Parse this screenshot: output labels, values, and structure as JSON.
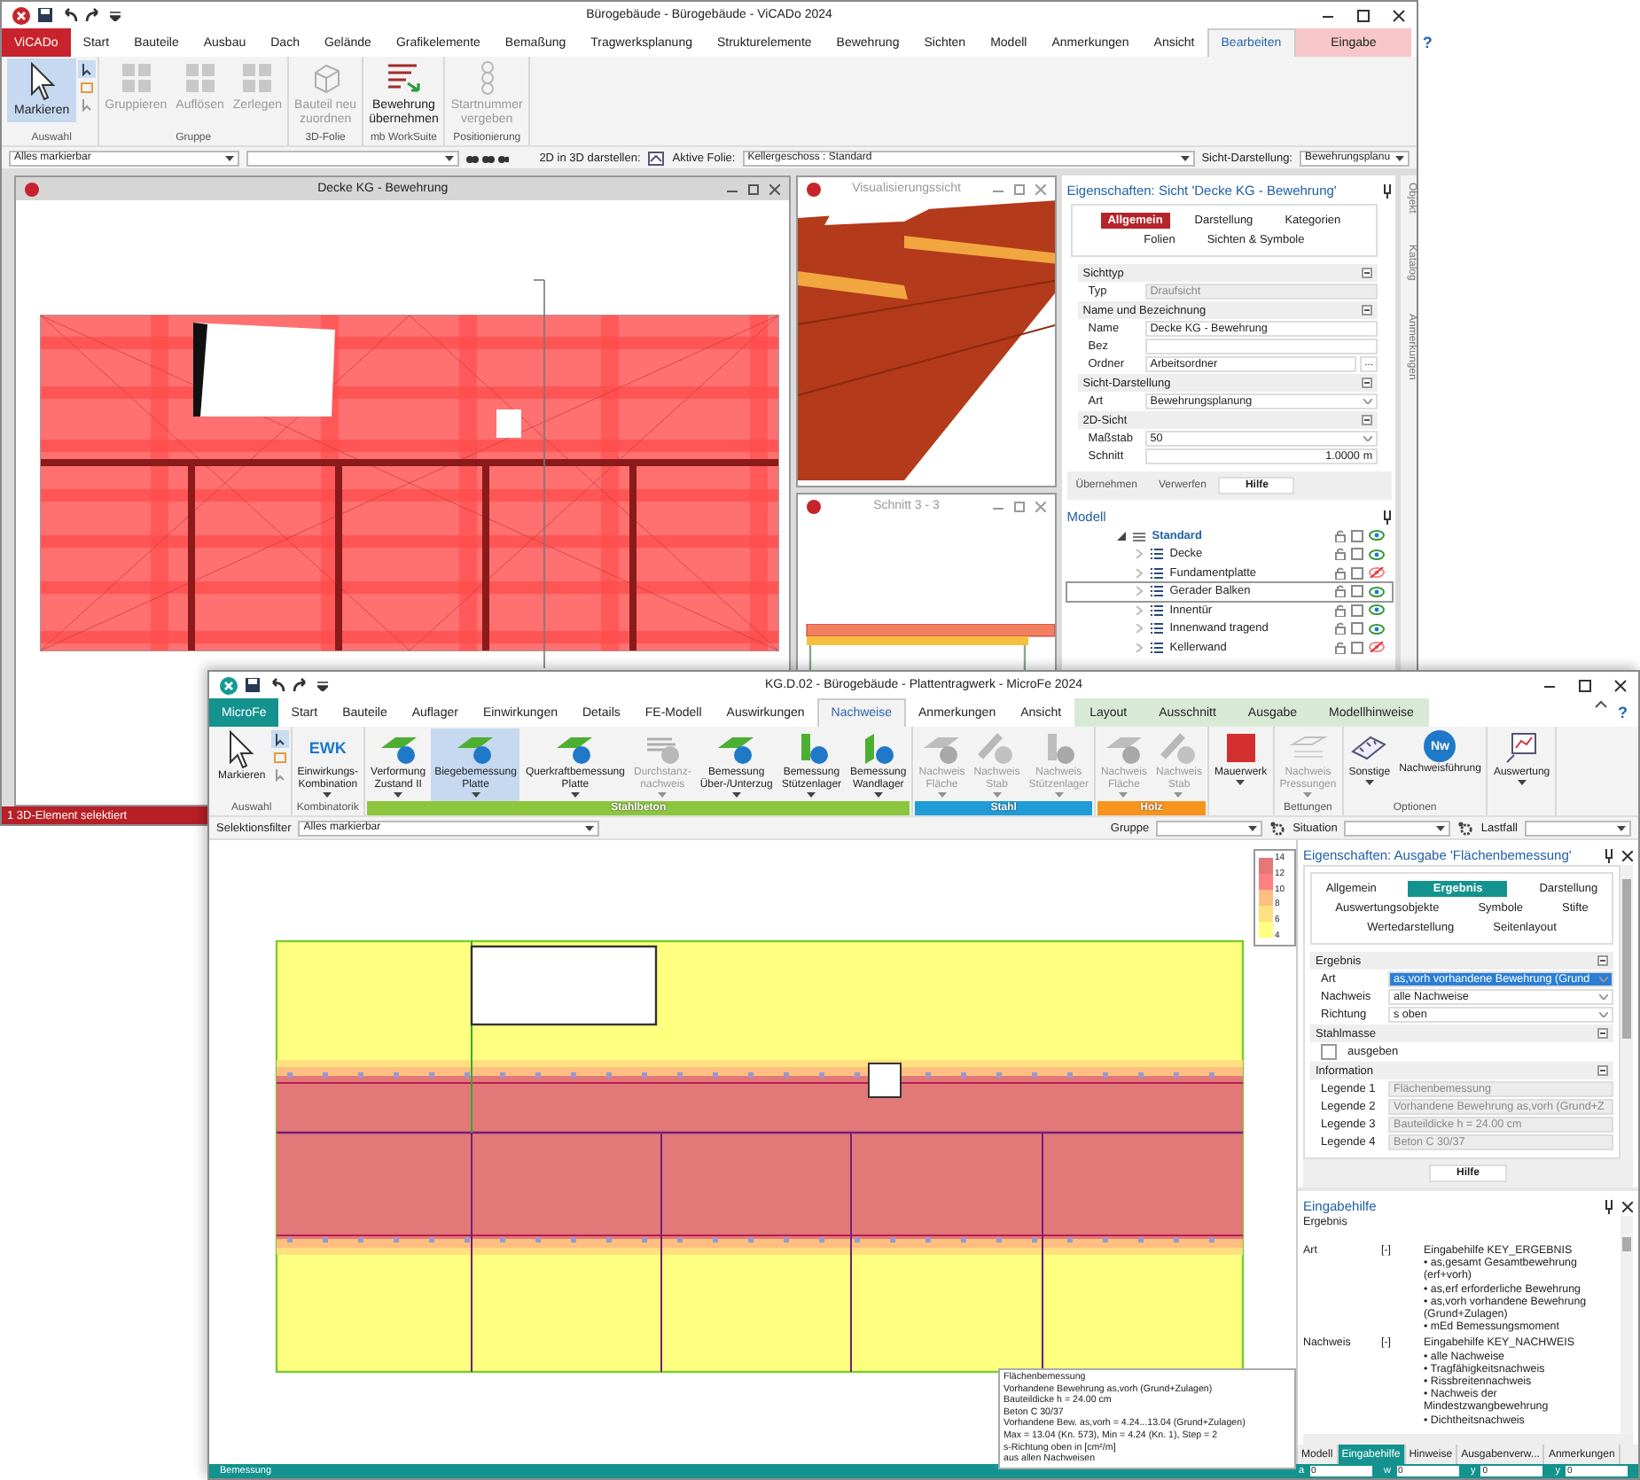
{
  "vicado": {
    "title": "Bürogebäude - Bürogebäude - ViCADo 2024",
    "help": "?",
    "tabs": [
      {
        "label": "ViCADo",
        "kind": "file",
        "selected": false
      },
      {
        "label": "Start",
        "kind": "tab",
        "selected": false
      },
      {
        "label": "Bauteile",
        "kind": "tab",
        "selected": false
      },
      {
        "label": "Ausbau",
        "kind": "tab",
        "selected": false
      },
      {
        "label": "Dach",
        "kind": "tab",
        "selected": false
      },
      {
        "label": "Gelände",
        "kind": "tab",
        "selected": false
      },
      {
        "label": "Grafikelemente",
        "kind": "tab",
        "selected": false
      },
      {
        "label": "Bemaßung",
        "kind": "tab",
        "selected": false
      },
      {
        "label": "Tragwerksplanung",
        "kind": "tab",
        "selected": false
      },
      {
        "label": "Strukturelemente",
        "kind": "tab",
        "selected": false
      },
      {
        "label": "Bewehrung",
        "kind": "tab",
        "selected": false
      },
      {
        "label": "Sichten",
        "kind": "tab",
        "selected": false
      },
      {
        "label": "Modell",
        "kind": "tab",
        "selected": false
      },
      {
        "label": "Anmerkungen",
        "kind": "tab",
        "selected": false
      },
      {
        "label": "Ansicht",
        "kind": "tab",
        "selected": false
      },
      {
        "label": "Bearbeiten",
        "kind": "tab",
        "selected": true
      },
      {
        "label": "Eingabe",
        "kind": "context",
        "selected": false
      }
    ],
    "ribbon": [
      {
        "label": "Auswahl",
        "buttons": [
          {
            "lines": [
              "Markieren"
            ],
            "kind": "cursor",
            "selected": true,
            "disabled": false
          }
        ]
      },
      {
        "label": "Gruppe",
        "buttons": [
          {
            "lines": [
              "Gruppieren"
            ],
            "kind": "group",
            "selected": false,
            "disabled": true
          },
          {
            "lines": [
              "Auflösen"
            ],
            "kind": "group",
            "selected": false,
            "disabled": true
          },
          {
            "lines": [
              "Zerlegen"
            ],
            "kind": "group",
            "selected": false,
            "disabled": true
          }
        ]
      },
      {
        "label": "3D-Folie",
        "buttons": [
          {
            "lines": [
              "Bauteil neu",
              "zuordnen"
            ],
            "kind": "cube",
            "selected": false,
            "disabled": true
          }
        ]
      },
      {
        "label": "mb WorkSuite",
        "buttons": [
          {
            "lines": [
              "Bewehrung",
              "übernehmen"
            ],
            "kind": "rebar",
            "selected": false,
            "disabled": false
          }
        ]
      },
      {
        "label": "Positionierung",
        "buttons": [
          {
            "lines": [
              "Startnummer",
              "vergeben"
            ],
            "kind": "number",
            "selected": false,
            "disabled": true
          }
        ]
      }
    ],
    "toolbar": {
      "selection": "Alles markierbar",
      "show_3d_label": "2D in 3D darstellen:",
      "layer_label": "Aktive Folie:",
      "layer": "Kellergeschoss : Standard",
      "style_label": "Sicht-Darstellung:",
      "style": "Bewehrungsplanu"
    },
    "views": [
      {
        "title": "Decke KG - Bewehrung",
        "kind": "plan"
      },
      {
        "title": "Visualisierungssicht",
        "kind": "render"
      },
      {
        "title": "Schnitt 3 - 3",
        "kind": "section"
      }
    ],
    "properties": {
      "title": "Eigenschaften: Sicht 'Decke KG - Bewehrung'",
      "tabs": [
        {
          "label": "Allgemein",
          "selected": true
        },
        {
          "label": "Darstellung",
          "selected": false
        },
        {
          "label": "Kategorien",
          "selected": false
        },
        {
          "label": "Folien",
          "selected": false
        },
        {
          "label": "Sichten & Symbole",
          "selected": false
        }
      ],
      "sections": [
        {
          "label": "Sichttyp",
          "rows": [
            {
              "label": "Typ",
              "value": "Draufsicht",
              "kind": "readonly"
            }
          ]
        },
        {
          "label": "Name und Bezeichnung",
          "rows": [
            {
              "label": "Name",
              "value": "Decke KG - Bewehrung",
              "kind": "text"
            },
            {
              "label": "Bez",
              "kind": "text"
            },
            {
              "label": "Ordner",
              "value": "Arbeitsordner",
              "kind": "browse",
              "button": "..."
            }
          ]
        },
        {
          "label": "Sicht-Darstellung",
          "rows": [
            {
              "label": "Art",
              "value": "Bewehrungsplanung",
              "kind": "dropdown"
            }
          ]
        },
        {
          "label": "2D-Sicht",
          "rows": [
            {
              "label": "Maßstab",
              "value": "50",
              "kind": "dropdown"
            },
            {
              "label": "Schnitt",
              "value": "1.0000",
              "unit": "m",
              "kind": "unit"
            }
          ]
        }
      ],
      "buttons": [
        {
          "label": "Übernehmen",
          "kind": "plain"
        },
        {
          "label": "Verwerfen",
          "kind": "plain"
        },
        {
          "label": "Hilfe",
          "kind": "bold"
        }
      ]
    },
    "model": {
      "title": "Modell",
      "tree": [
        {
          "label": "Standard",
          "expanded": true,
          "visible": true,
          "selected": false,
          "children": [
            {
              "label": "Decke",
              "expanded": false,
              "visible": true,
              "selected": false
            },
            {
              "label": "Fundamentplatte",
              "expanded": false,
              "visible": false,
              "selected": false
            },
            {
              "label": "Gerader Balken",
              "expanded": false,
              "visible": true,
              "selected": true
            },
            {
              "label": "Innentür",
              "expanded": false,
              "visible": true,
              "selected": false
            },
            {
              "label": "Innenwand tragend",
              "expanded": false,
              "visible": true,
              "selected": false
            },
            {
              "label": "Kellerwand",
              "expanded": false,
              "visible": false,
              "selected": false
            }
          ]
        }
      ]
    },
    "side_tabs": [
      "Objekt",
      "Katalog",
      "Anmerkungen"
    ],
    "status": "1 3D-Element selektiert"
  },
  "microfe": {
    "title": "KG.D.02 - Bürogebäude - Plattentragwerk - MicroFe 2024",
    "help": "?",
    "tabs": [
      {
        "label": "MicroFe",
        "kind": "file",
        "selected": false
      },
      {
        "label": "Start",
        "kind": "tab",
        "selected": false
      },
      {
        "label": "Bauteile",
        "kind": "tab",
        "selected": false
      },
      {
        "label": "Auflager",
        "kind": "tab",
        "selected": false
      },
      {
        "label": "Einwirkungen",
        "kind": "tab",
        "selected": false
      },
      {
        "label": "Details",
        "kind": "tab",
        "selected": false
      },
      {
        "label": "FE-Modell",
        "kind": "tab",
        "selected": false
      },
      {
        "label": "Auswirkungen",
        "kind": "tab",
        "selected": false
      },
      {
        "label": "Nachweise",
        "kind": "tab",
        "selected": true
      },
      {
        "label": "Anmerkungen",
        "kind": "tab",
        "selected": false
      },
      {
        "label": "Ansicht",
        "kind": "tab",
        "selected": false
      },
      {
        "label": "Layout",
        "kind": "context",
        "selected": false
      },
      {
        "label": "Ausschnitt",
        "kind": "context",
        "selected": false
      },
      {
        "label": "Ausgabe",
        "kind": "context",
        "selected": false
      },
      {
        "label": "Modellhinweise",
        "kind": "context",
        "selected": false
      }
    ],
    "ribbon": [
      {
        "label": "Auswahl",
        "buttons": [
          {
            "lines": [
              "Markieren"
            ],
            "kind": "cursor",
            "selected": false,
            "disabled": false,
            "menu": false
          }
        ]
      },
      {
        "label": "Kombinatorik",
        "buttons": [
          {
            "lines": [
              "Einwirkungs-",
              "Kombination"
            ],
            "kind": "text_icon",
            "icon_text": "EWK",
            "selected": false,
            "disabled": false,
            "menu": true
          }
        ]
      },
      {
        "label": "Stahlbeton",
        "color": "#8cc63f",
        "buttons": [
          {
            "lines": [
              "Verformung",
              "Zustand II"
            ],
            "kind": "slab",
            "selected": false,
            "disabled": false,
            "menu": true
          },
          {
            "lines": [
              "Biegebemessung",
              "Platte"
            ],
            "kind": "slab",
            "selected": true,
            "disabled": false,
            "menu": true
          },
          {
            "lines": [
              "Querkraftbemessung",
              "Platte"
            ],
            "kind": "slab",
            "selected": false,
            "disabled": false,
            "menu": true
          },
          {
            "lines": [
              "Durchstanz-",
              "nachweis"
            ],
            "kind": "punch",
            "selected": false,
            "disabled": true,
            "menu": true
          },
          {
            "lines": [
              "Bemessung",
              "Über-/Unterzug"
            ],
            "kind": "slab",
            "selected": false,
            "disabled": false,
            "menu": true
          },
          {
            "lines": [
              "Bemessung",
              "Stützenlager"
            ],
            "kind": "column",
            "selected": false,
            "disabled": false,
            "menu": true
          },
          {
            "lines": [
              "Bemessung",
              "Wandlager"
            ],
            "kind": "wall",
            "selected": false,
            "disabled": false,
            "menu": true
          }
        ]
      },
      {
        "label": "Stahl",
        "color": "#1f9bd7",
        "buttons": [
          {
            "lines": [
              "Nachweis",
              "Fläche"
            ],
            "kind": "slab",
            "selected": false,
            "disabled": true,
            "menu": true
          },
          {
            "lines": [
              "Nachweis",
              "Stab"
            ],
            "kind": "bar",
            "selected": false,
            "disabled": true,
            "menu": true
          },
          {
            "lines": [
              "Nachweis",
              "Stützenlager"
            ],
            "kind": "column",
            "selected": false,
            "disabled": true,
            "menu": true
          }
        ]
      },
      {
        "label": "Holz",
        "color": "#f7941d",
        "buttons": [
          {
            "lines": [
              "Nachweis",
              "Fläche"
            ],
            "kind": "slab",
            "selected": false,
            "disabled": true,
            "menu": true
          },
          {
            "lines": [
              "Nachweis",
              "Stab"
            ],
            "kind": "bar",
            "selected": false,
            "disabled": true,
            "menu": true
          }
        ]
      },
      {
        "buttons": [
          {
            "lines": [
              "Mauerwerk"
            ],
            "kind": "block",
            "selected": false,
            "disabled": false,
            "menu": true
          }
        ]
      },
      {
        "label": "Bettungen",
        "buttons": [
          {
            "lines": [
              "Nachweis",
              "Pressungen"
            ],
            "kind": "press",
            "selected": false,
            "disabled": true,
            "menu": true
          }
        ]
      },
      {
        "label": "Optionen",
        "buttons": [
          {
            "lines": [
              "Sonstige"
            ],
            "kind": "tool",
            "selected": false,
            "disabled": false,
            "menu": true
          },
          {
            "lines": [
              "Nachweisführung"
            ],
            "kind": "badge",
            "icon_text": "Nw",
            "selected": false,
            "disabled": false,
            "menu": false
          }
        ]
      },
      {
        "buttons": [
          {
            "lines": [
              "Auswertung"
            ],
            "kind": "chart",
            "selected": false,
            "disabled": false,
            "menu": true
          }
        ]
      }
    ],
    "toolbar": {
      "filter_label": "Selektionsfilter",
      "filter": "Alles markierbar",
      "group_label": "Gruppe",
      "situation_label": "Situation",
      "loadcase_label": "Lastfall"
    },
    "legend": {
      "ticks": [
        "14",
        "12",
        "10",
        "8",
        "6",
        "4"
      ],
      "bands": [
        {
          "color": "#e27878"
        },
        {
          "color": "#ff8080"
        },
        {
          "color": "#ffbf80"
        },
        {
          "color": "#ffdf80"
        },
        {
          "color": "#ffff80"
        }
      ]
    },
    "info": [
      "Flächenbemessung",
      "Vorhandene Bewehrung as,vorh (Grund+Zulagen)",
      "Bauteildicke h = 24.00 cm",
      "Beton C 30/37",
      "Vorhandene Bew. as,vorh = 4.24...13.04 (Grund+Zulagen)",
      "Max = 13.04 (Kn. 573), Min = 4.24 (Kn. 1), Step = 2",
      "s-Richtung oben in [cm²/m]",
      "aus allen Nachweisen"
    ],
    "properties": {
      "title": "Eigenschaften: Ausgabe 'Flächenbemessung'",
      "tabs": [
        {
          "label": "Allgemein",
          "selected": false
        },
        {
          "label": "Ergebnis",
          "selected": true
        },
        {
          "label": "Darstellung",
          "selected": false
        },
        {
          "label": "Auswertungsobjekte",
          "selected": false
        },
        {
          "label": "Symbole",
          "selected": false
        },
        {
          "label": "Stifte",
          "selected": false
        },
        {
          "label": "Wertedarstellung",
          "selected": false
        },
        {
          "label": "Seitenlayout",
          "selected": false
        }
      ],
      "sections": [
        {
          "label": "Ergebnis",
          "rows": [
            {
              "label": "Art",
              "value": "as,vorh vorhandene Bewehrung (Grund",
              "kind": "dropdown",
              "focused": true
            },
            {
              "label": "Nachweis",
              "value": "alle Nachweise",
              "kind": "dropdown",
              "focused": false
            },
            {
              "label": "Richtung",
              "value": "s oben",
              "kind": "dropdown",
              "focused": false
            }
          ]
        },
        {
          "label": "Stahlmasse",
          "rows": [
            {
              "label": "ausgeben",
              "kind": "checkbox",
              "checked": false
            }
          ]
        },
        {
          "label": "Information",
          "rows": [
            {
              "label": "Legende 1",
              "value": "Flächenbemessung",
              "kind": "readonly"
            },
            {
              "label": "Legende 2",
              "value": "Vorhandene Bewehrung as,vorh (Grund+Z",
              "kind": "readonly"
            },
            {
              "label": "Legende 3",
              "value": "Bauteildicke h = 24.00 cm",
              "kind": "readonly"
            },
            {
              "label": "Legende 4",
              "value": "Beton C 30/37",
              "kind": "readonly"
            }
          ]
        }
      ],
      "buttons": [
        {
          "label": "Hilfe",
          "kind": "bold"
        }
      ]
    },
    "help_panel": {
      "title": "Eingabehilfe",
      "heading": "Ergebnis",
      "entries": [
        {
          "key": "Art",
          "toggle": "[-]",
          "lines": [
            "Eingabehilfe KEY_ERGEBNIS",
            "• as,gesamt Gesamtbewehrung (erf+vorh)",
            "• as,erf erforderliche Bewehrung",
            "• as,vorh vorhandene Bewehrung (Grund+Zulagen)",
            "• mEd Bemessungsmoment"
          ]
        },
        {
          "key": "Nachweis",
          "toggle": "[-]",
          "lines": [
            "Eingabehilfe KEY_NACHWEIS",
            "• alle Nachweise",
            "• Tragfähigkeitsnachweis",
            "• Rissbreitennachweis",
            "• Nachweis der Mindestzwangbewehrung",
            "• Dichtheitsnachweis"
          ]
        }
      ]
    },
    "bottom_tabs": [
      {
        "label": "Modell",
        "selected": false
      },
      {
        "label": "Eingabehilfe",
        "selected": true
      },
      {
        "label": "Hinweise",
        "selected": false
      },
      {
        "label": "Ausgabenverw...",
        "selected": false
      },
      {
        "label": "Anmerkungen",
        "selected": false
      }
    ],
    "status": {
      "label": "Bemessung",
      "fields": [
        {
          "label": "a",
          "value": "0"
        },
        {
          "label": "w",
          "value": "0"
        },
        {
          "label": "y",
          "value": "0"
        },
        {
          "label": "y",
          "value": "0"
        }
      ]
    }
  }
}
